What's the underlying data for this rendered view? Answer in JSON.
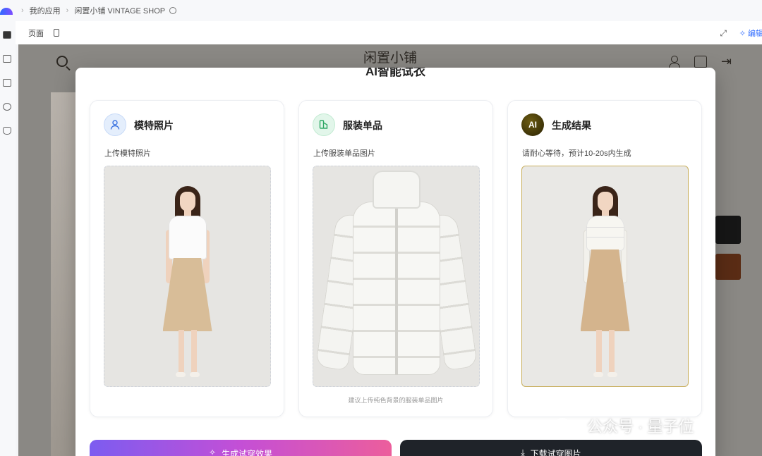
{
  "breadcrumb": {
    "items": [
      "我的应用",
      "闲置小铺 VINTAGE SHOP"
    ]
  },
  "subheader": {
    "page_label": "页面",
    "edit_label": "编辑"
  },
  "shop": {
    "title": "闲置小铺"
  },
  "modal": {
    "title": "AI智能试衣",
    "cards": [
      {
        "title": "模特照片",
        "subtitle": "上传模特照片",
        "icon": "person-icon"
      },
      {
        "title": "服装单品",
        "subtitle": "上传服装单品图片",
        "hint": "建议上传纯色背景的服装单品图片",
        "icon": "garment-icon"
      },
      {
        "title": "生成结果",
        "subtitle": "请耐心等待，预计10-20s内生成",
        "icon_text": "AI"
      }
    ],
    "generate_label": "生成试穿效果",
    "download_label": "下载试穿图片"
  },
  "watermark": {
    "text": "公众号 · 量子位"
  },
  "colors": {
    "accent": "#2f6bff",
    "generate_gradient_start": "#7c5cf0",
    "generate_gradient_end": "#ec5e9c",
    "download_bg": "#1f2329"
  }
}
